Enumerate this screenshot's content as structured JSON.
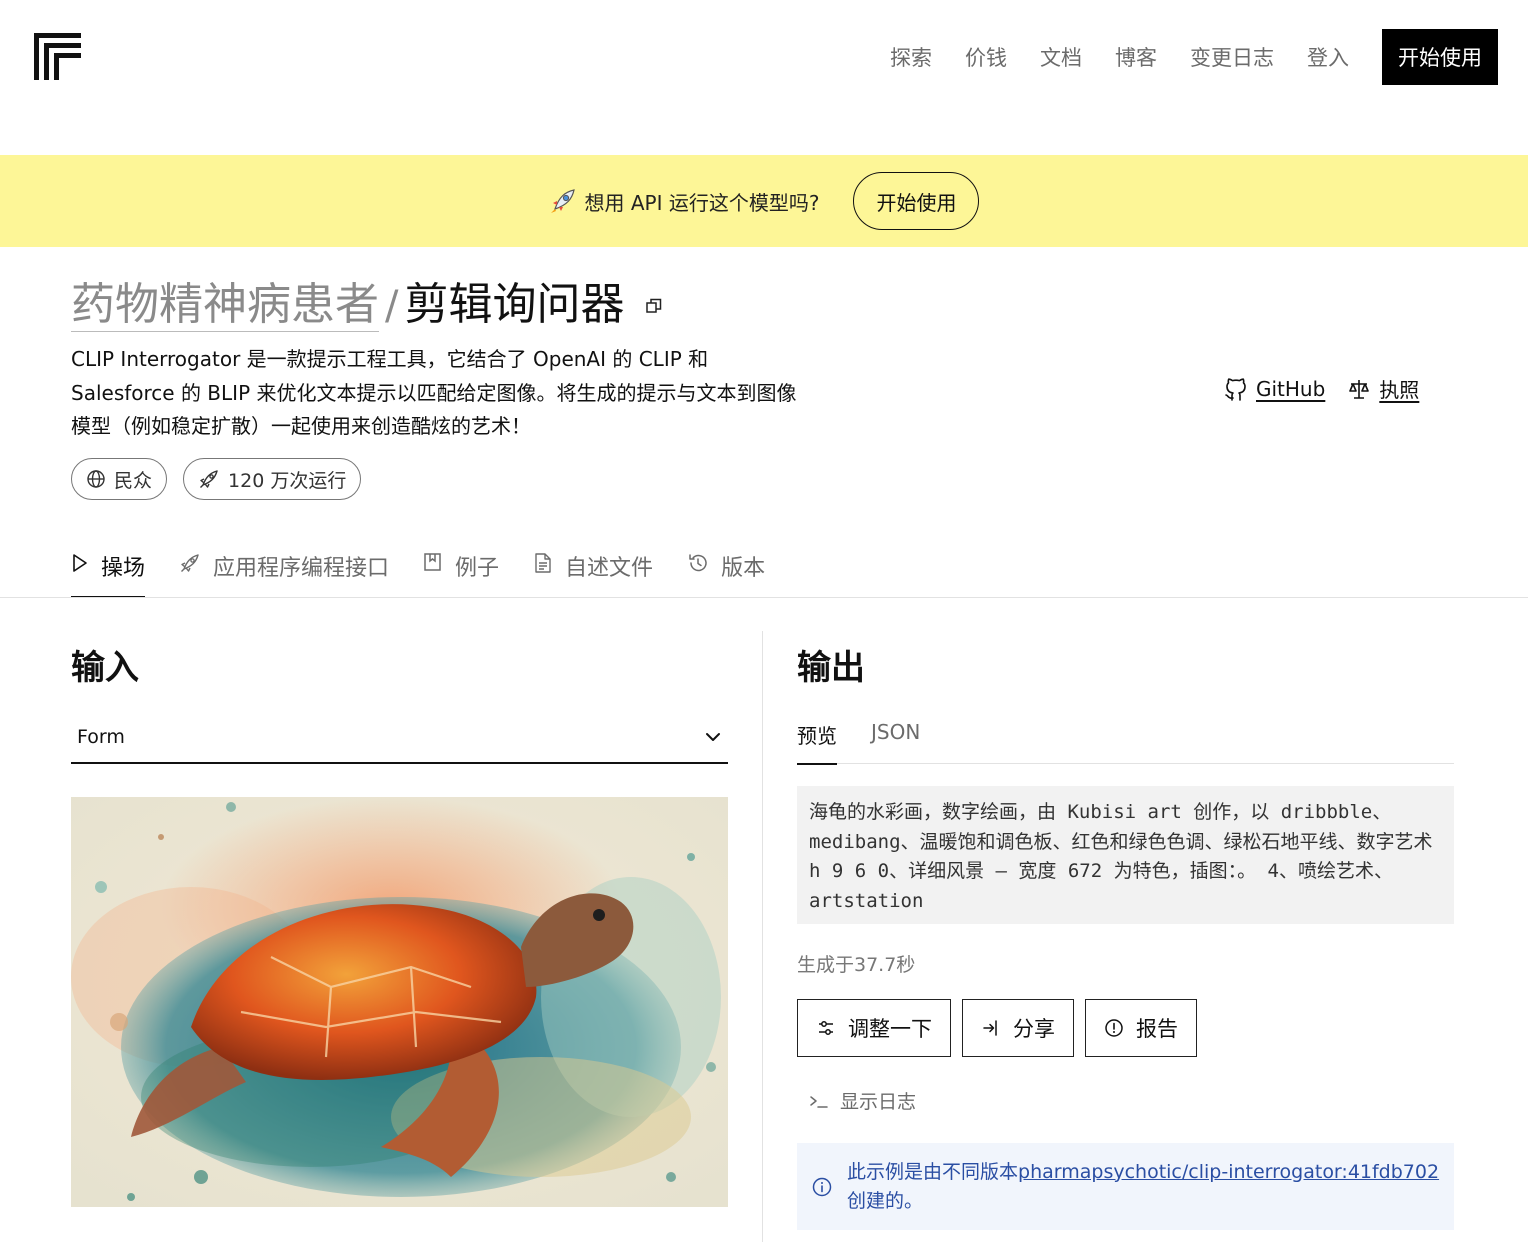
{
  "header": {
    "nav": [
      "探索",
      "价钱",
      "文档",
      "博客",
      "变更日志",
      "登入"
    ],
    "cta_label": "开始使用"
  },
  "banner": {
    "text": "想用 API 运行这个模型吗?",
    "button_label": "开始使用"
  },
  "model": {
    "owner": "药物精神病患者",
    "separator": "/",
    "name": "剪辑询问器",
    "description_lines": [
      "CLIP Interrogator 是一款提示工程工具，它结合了 OpenAI 的 CLIP 和",
      "Salesforce 的 BLIP 来优化文本提示以匹配给定图像。将生成的提示与文本到图像",
      "模型（例如稳定扩散）一起使用来创造酷炫的艺术！"
    ],
    "github_label": "GitHub",
    "license_label": "执照",
    "visibility_label": "民众",
    "runs_label": "120 万次运行"
  },
  "tabs": [
    {
      "label": "操场",
      "icon": "play-icon",
      "active": true
    },
    {
      "label": "应用程序编程接口",
      "icon": "rocket-icon",
      "active": false
    },
    {
      "label": "例子",
      "icon": "bookmark-icon",
      "active": false
    },
    {
      "label": "自述文件",
      "icon": "document-icon",
      "active": false
    },
    {
      "label": "版本",
      "icon": "history-icon",
      "active": false
    }
  ],
  "input": {
    "heading": "输入",
    "form_select_value": "Form"
  },
  "output": {
    "heading": "输出",
    "tabs": [
      "预览",
      "JSON"
    ],
    "text": "海龟的水彩画，数字绘画，由 Kubisi art 创作，以 dribbble、medibang、温暖饱和调色板、红色和绿色色调、绿松石地平线、数字艺术 h 9 6 0、详细风景 — 宽度 672 为特色，插图：。 4、喷绘艺术、artstation",
    "generated_time": "生成于37.7秒",
    "actions": [
      "调整一下",
      "分享",
      "报告"
    ],
    "show_logs_label": "显示日志",
    "info_prefix": "此示例是由不同版本",
    "info_link": "pharmapsychotic/clip-interrogator:41fdb702",
    "info_suffix": "创建的。"
  },
  "colors": {
    "banner_bg": "#fdf697",
    "cta_bg": "#000000",
    "info_bg": "#f1f5fc",
    "info_text": "#2a4ea3",
    "output_bg": "#f2f2f2"
  }
}
